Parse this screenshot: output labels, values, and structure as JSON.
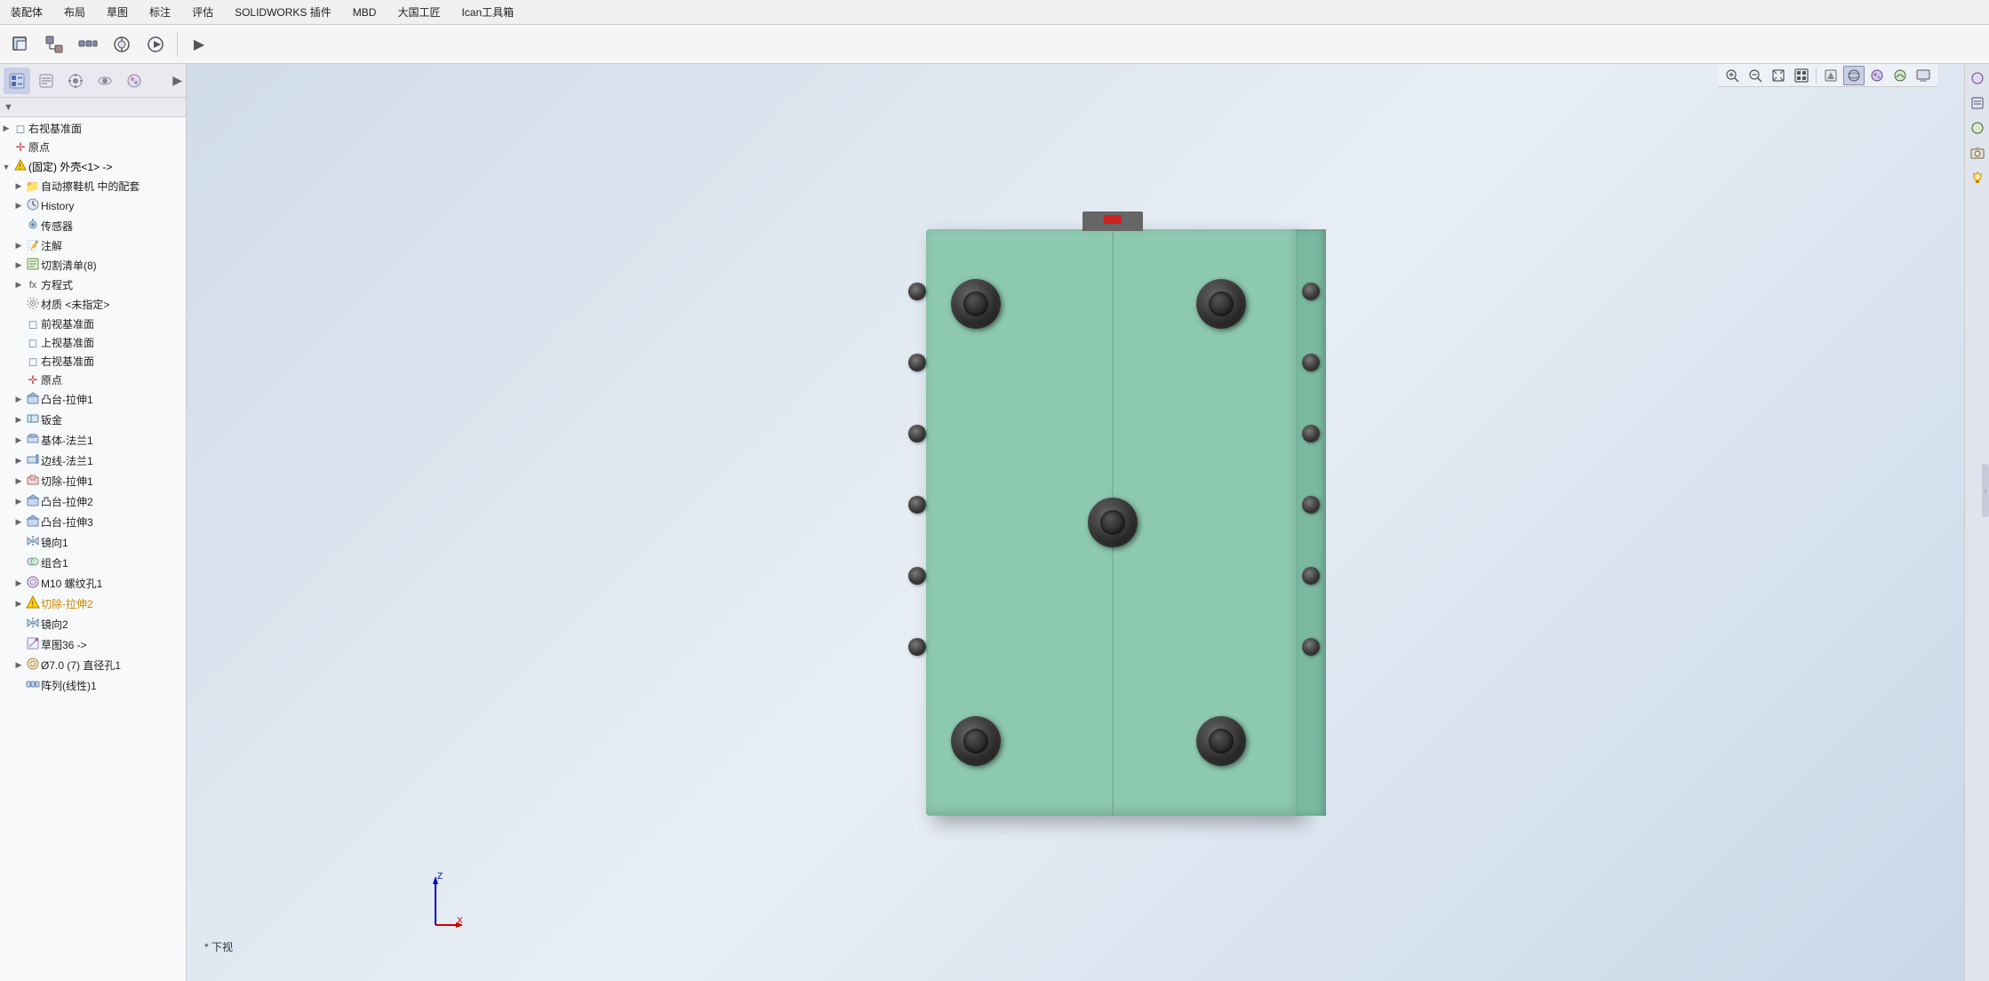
{
  "menubar": {
    "items": [
      "装配体",
      "布局",
      "草图",
      "标注",
      "评估",
      "SOLIDWORKS 插件",
      "MBD",
      "大国工匠",
      "Ican工具箱"
    ]
  },
  "toolbar": {
    "buttons": [
      {
        "icon": "⊕",
        "label": "插入零部件"
      },
      {
        "icon": "▦",
        "label": "配合"
      },
      {
        "icon": "⚙",
        "label": "线性零部件阵列"
      },
      {
        "icon": "⊕",
        "label": "智能扣件"
      },
      {
        "icon": "◎",
        "label": "新建运动算例"
      },
      {
        "icon": "▶",
        "label": "更多"
      }
    ]
  },
  "left_panel": {
    "tabs": [
      {
        "icon": "🔧",
        "label": "装配体",
        "active": true
      },
      {
        "icon": "📋",
        "label": "属性"
      },
      {
        "icon": "⚙",
        "label": "配置"
      },
      {
        "icon": "📊",
        "label": "显示"
      },
      {
        "icon": "🔍",
        "label": "外观"
      }
    ],
    "filter": "▼",
    "tree": [
      {
        "level": 1,
        "arrow": "▶",
        "icon": "📄",
        "label": "右视基准面",
        "indent": 0
      },
      {
        "level": 1,
        "arrow": "",
        "icon": "✛",
        "label": "原点",
        "indent": 0
      },
      {
        "level": 0,
        "arrow": "▼",
        "icon": "⚠",
        "label": "(固定) 外壳<1> ->",
        "indent": 0,
        "warning": true
      },
      {
        "level": 1,
        "arrow": "▶",
        "icon": "📄",
        "label": "自动擦鞋机 中的配套",
        "indent": 1
      },
      {
        "level": 1,
        "arrow": "▶",
        "icon": "🕐",
        "label": "History",
        "indent": 1
      },
      {
        "level": 1,
        "arrow": "",
        "icon": "📡",
        "label": "传感器",
        "indent": 1
      },
      {
        "level": 1,
        "arrow": "▶",
        "icon": "📝",
        "label": "注解",
        "indent": 1
      },
      {
        "level": 1,
        "arrow": "▶",
        "icon": "✂",
        "label": "切割清单(8)",
        "indent": 1
      },
      {
        "level": 1,
        "arrow": "▶",
        "icon": "fx",
        "label": "方程式",
        "indent": 1
      },
      {
        "level": 1,
        "arrow": "",
        "icon": "⚙",
        "label": "材质 <未指定>",
        "indent": 1
      },
      {
        "level": 1,
        "arrow": "",
        "icon": "📄",
        "label": "前视基准面",
        "indent": 1
      },
      {
        "level": 1,
        "arrow": "",
        "icon": "📄",
        "label": "上视基准面",
        "indent": 1
      },
      {
        "level": 1,
        "arrow": "",
        "icon": "📄",
        "label": "右视基准面",
        "indent": 1
      },
      {
        "level": 1,
        "arrow": "",
        "icon": "✛",
        "label": "原点",
        "indent": 1
      },
      {
        "level": 1,
        "arrow": "▶",
        "icon": "🔷",
        "label": "凸台-拉伸1",
        "indent": 1
      },
      {
        "level": 1,
        "arrow": "▶",
        "icon": "🔷",
        "label": "钣金",
        "indent": 1
      },
      {
        "level": 1,
        "arrow": "▶",
        "icon": "🔷",
        "label": "基体-法兰1",
        "indent": 1
      },
      {
        "level": 1,
        "arrow": "▶",
        "icon": "🔷",
        "label": "边线-法兰1",
        "indent": 1
      },
      {
        "level": 1,
        "arrow": "▶",
        "icon": "✂",
        "label": "切除-拉伸1",
        "indent": 1
      },
      {
        "level": 1,
        "arrow": "▶",
        "icon": "🔷",
        "label": "凸台-拉伸2",
        "indent": 1
      },
      {
        "level": 1,
        "arrow": "▶",
        "icon": "🔷",
        "label": "凸台-拉伸3",
        "indent": 1
      },
      {
        "level": 1,
        "arrow": "",
        "icon": "🔷",
        "label": "镜向1",
        "indent": 1
      },
      {
        "level": 1,
        "arrow": "",
        "icon": "🔷",
        "label": "组合1",
        "indent": 1
      },
      {
        "level": 1,
        "arrow": "▶",
        "icon": "🔩",
        "label": "M10 螺纹孔1",
        "indent": 1
      },
      {
        "level": 1,
        "arrow": "▶",
        "icon": "⚠✂",
        "label": "切除-拉伸2",
        "indent": 1,
        "warning": true
      },
      {
        "level": 1,
        "arrow": "",
        "icon": "🔷",
        "label": "镜向2",
        "indent": 1
      },
      {
        "level": 1,
        "arrow": "",
        "icon": "📐",
        "label": "草图36 ->",
        "indent": 1
      },
      {
        "level": 1,
        "arrow": "▶",
        "icon": "⭕",
        "label": "Ø7.0 (7) 直径孔1",
        "indent": 1
      },
      {
        "level": 1,
        "arrow": "",
        "icon": "🔷",
        "label": "阵列(线性)1",
        "indent": 1
      }
    ]
  },
  "viewport": {
    "view_label": "* 下视",
    "part_color": "#8dc8b0"
  },
  "right_icons": {
    "buttons": [
      {
        "icon": "👁",
        "label": "外观"
      },
      {
        "icon": "📋",
        "label": "属性"
      },
      {
        "icon": "🌐",
        "label": "场景"
      },
      {
        "icon": "📊",
        "label": "相机"
      },
      {
        "icon": "💡",
        "label": "光源"
      }
    ]
  },
  "top_right_toolbar": {
    "buttons": [
      {
        "icon": "🔍",
        "label": "放大"
      },
      {
        "icon": "🔎",
        "label": "缩小"
      },
      {
        "icon": "🗂",
        "label": "适合窗口"
      },
      {
        "icon": "⊞",
        "label": "整屏显示"
      },
      {
        "icon": "✏",
        "label": "标注"
      },
      {
        "icon": "▣",
        "label": "视图定向"
      },
      {
        "icon": "👁",
        "label": "显示模式",
        "active": true
      },
      {
        "icon": "🎨",
        "label": "外观"
      },
      {
        "icon": "🌈",
        "label": "场景"
      },
      {
        "icon": "🖥",
        "label": "视图设置"
      }
    ]
  }
}
